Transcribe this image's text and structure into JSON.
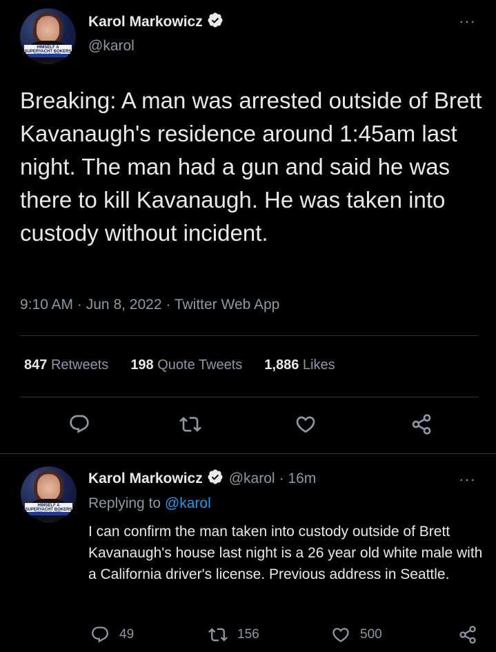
{
  "main_tweet": {
    "author": {
      "display_name": "Karol Markowicz",
      "handle": "@karol",
      "avatar_banner_text": "HIMSELF A SUPERYACHT BOKERS PEE IN BOTTL"
    },
    "text": "Breaking: A man was arrested outside of Brett Kavanaugh's residence around 1:45am last night. The man had a gun and said he was there to kill Kavanaugh. He was taken into custody without incident.",
    "time": "9:10 AM",
    "date": "Jun 8, 2022",
    "source": "Twitter Web App",
    "separator": "·",
    "stats": {
      "retweets_count": "847",
      "retweets_label": "Retweets",
      "quotes_count": "198",
      "quotes_label": "Quote Tweets",
      "likes_count": "1,886",
      "likes_label": "Likes"
    },
    "actions": [
      "reply-icon",
      "retweet-icon",
      "like-icon",
      "share-icon"
    ]
  },
  "reply_tweet": {
    "author": {
      "display_name": "Karol Markowicz",
      "handle": "@karol",
      "avatar_banner_text": "HIMSELF A SUPERYACHT BOKERS PEE IN BOTTL"
    },
    "time_ago": "· 16m",
    "replying_prefix": "Replying to",
    "replying_to": "@karol",
    "text": "I can confirm the man taken into custody outside of Brett Kavanaugh's house last night is a 26 year old white male with a California driver's license. Previous address in Seattle.",
    "replies": "49",
    "retweets": "156",
    "likes": "500"
  },
  "colors": {
    "background": "#000000",
    "text_primary": "#e7e9ea",
    "text_secondary": "#8b98a5",
    "accent": "#1d9bf0",
    "divider": "#2f3336"
  }
}
